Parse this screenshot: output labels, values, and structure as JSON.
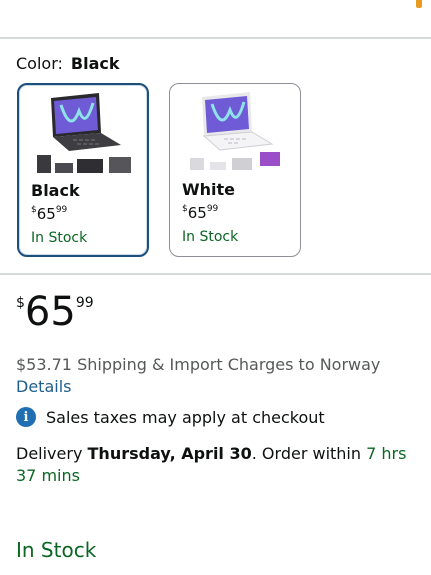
{
  "color_selector": {
    "label": "Color:",
    "selected": "Black",
    "options": [
      {
        "name": "Black",
        "price_symbol": "$",
        "price_whole": "65",
        "price_fraction": "99",
        "availability": "In Stock",
        "selected": true
      },
      {
        "name": "White",
        "price_symbol": "$",
        "price_whole": "65",
        "price_fraction": "99",
        "availability": "In Stock",
        "selected": false
      }
    ]
  },
  "price": {
    "symbol": "$",
    "whole": "65",
    "fraction": "99"
  },
  "shipping": {
    "text": "$53.71 Shipping & Import Charges to Norway",
    "details_link": "Details"
  },
  "tax_notice": {
    "icon": "info-icon",
    "text": "Sales taxes may apply at checkout"
  },
  "delivery": {
    "prefix": "Delivery",
    "date": "Thursday, April 30",
    "middle": ". Order within",
    "time": "7 hrs 37 mins"
  },
  "availability": "In Stock",
  "colors": {
    "accent_link": "#1f5f8b",
    "in_stock_green": "#0b6623",
    "selected_border": "#1c4f7c"
  }
}
